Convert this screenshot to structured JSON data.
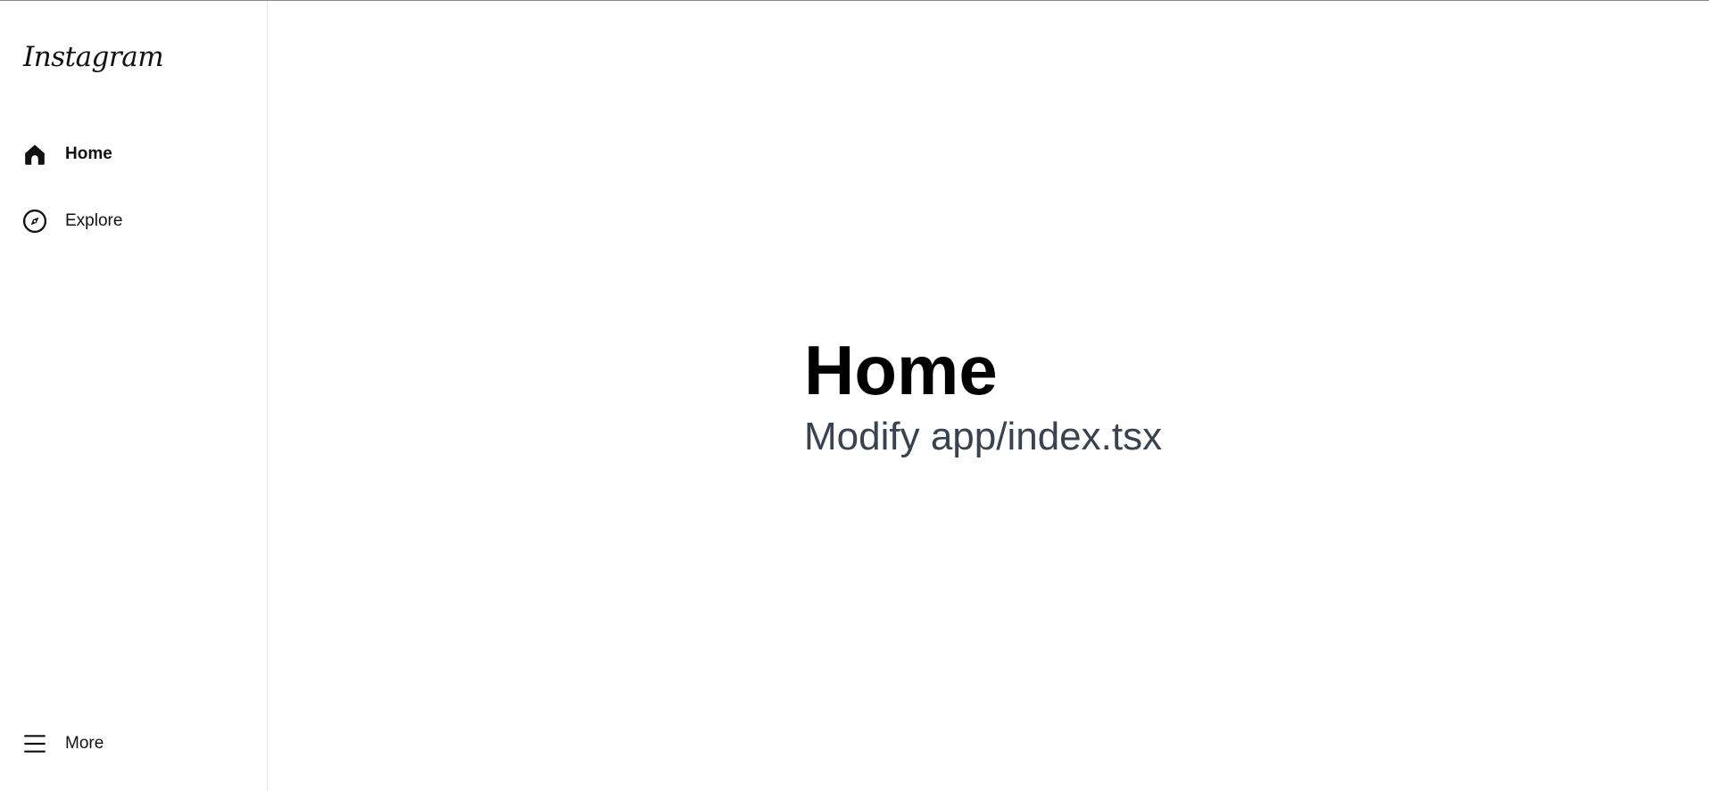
{
  "sidebar": {
    "logo": "Instagram",
    "items": [
      {
        "label": "Home",
        "icon": "home-icon",
        "active": true
      },
      {
        "label": "Explore",
        "icon": "compass-icon",
        "active": false
      }
    ],
    "more": {
      "label": "More",
      "icon": "menu-icon"
    }
  },
  "main": {
    "title": "Home",
    "subtitle": "Modify app/index.tsx"
  },
  "colors": {
    "text": "#111111",
    "subtitle": "#38434f",
    "border": "#e6e6e6",
    "background": "#ffffff"
  }
}
